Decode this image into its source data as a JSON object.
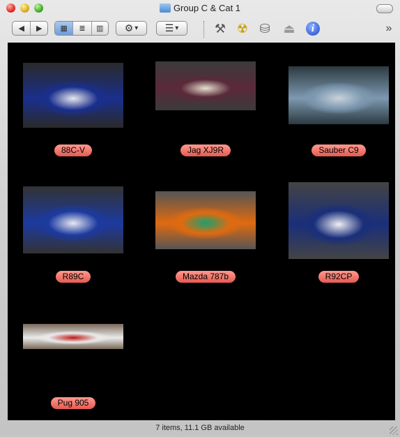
{
  "window": {
    "title": "Group C & Cat 1"
  },
  "toolbar": {
    "nav": {
      "back": "◀",
      "forward": "▶"
    },
    "view_modes": [
      {
        "name": "icon-view",
        "glyph": "▦",
        "selected": true
      },
      {
        "name": "list-view",
        "glyph": "≣",
        "selected": false
      },
      {
        "name": "column-view",
        "glyph": "▥",
        "selected": false
      }
    ],
    "action": {
      "glyph": "⚙",
      "arrow": "▾"
    },
    "arrange": {
      "glyph": "☰",
      "arrow": "▾"
    },
    "tools": [
      {
        "name": "utilities-icon",
        "glyph": "⚒"
      },
      {
        "name": "burn-icon",
        "glyph": "☢"
      },
      {
        "name": "disk-icon",
        "glyph": "⛁"
      },
      {
        "name": "eject-icon",
        "glyph": "⏏"
      },
      {
        "name": "info-icon",
        "glyph": "i"
      }
    ],
    "overflow": "»"
  },
  "items": [
    {
      "label": "88C-V",
      "colors": [
        "#1a2f8c",
        "#e8e8ee",
        "#2a2a2a"
      ]
    },
    {
      "label": "Jag XJ9R",
      "colors": [
        "#5a2a3a",
        "#e6e0d0",
        "#3b3b3b"
      ]
    },
    {
      "label": "Sauber C9",
      "colors": [
        "#7d98b0",
        "#c8d2da",
        "#2c3a40"
      ]
    },
    {
      "label": "R89C",
      "colors": [
        "#1c3aa0",
        "#e8e8f0",
        "#333"
      ]
    },
    {
      "label": "Mazda 787b",
      "colors": [
        "#e06a10",
        "#1aa070",
        "#555"
      ]
    },
    {
      "label": "R92CP",
      "colors": [
        "#1a2f7a",
        "#f0f0f5",
        "#444"
      ]
    },
    {
      "label": "Pug 905",
      "colors": [
        "#eaeaea",
        "#c01818",
        "#7a6a5a"
      ]
    }
  ],
  "status": {
    "text": "7 items, 11.1 GB available"
  }
}
